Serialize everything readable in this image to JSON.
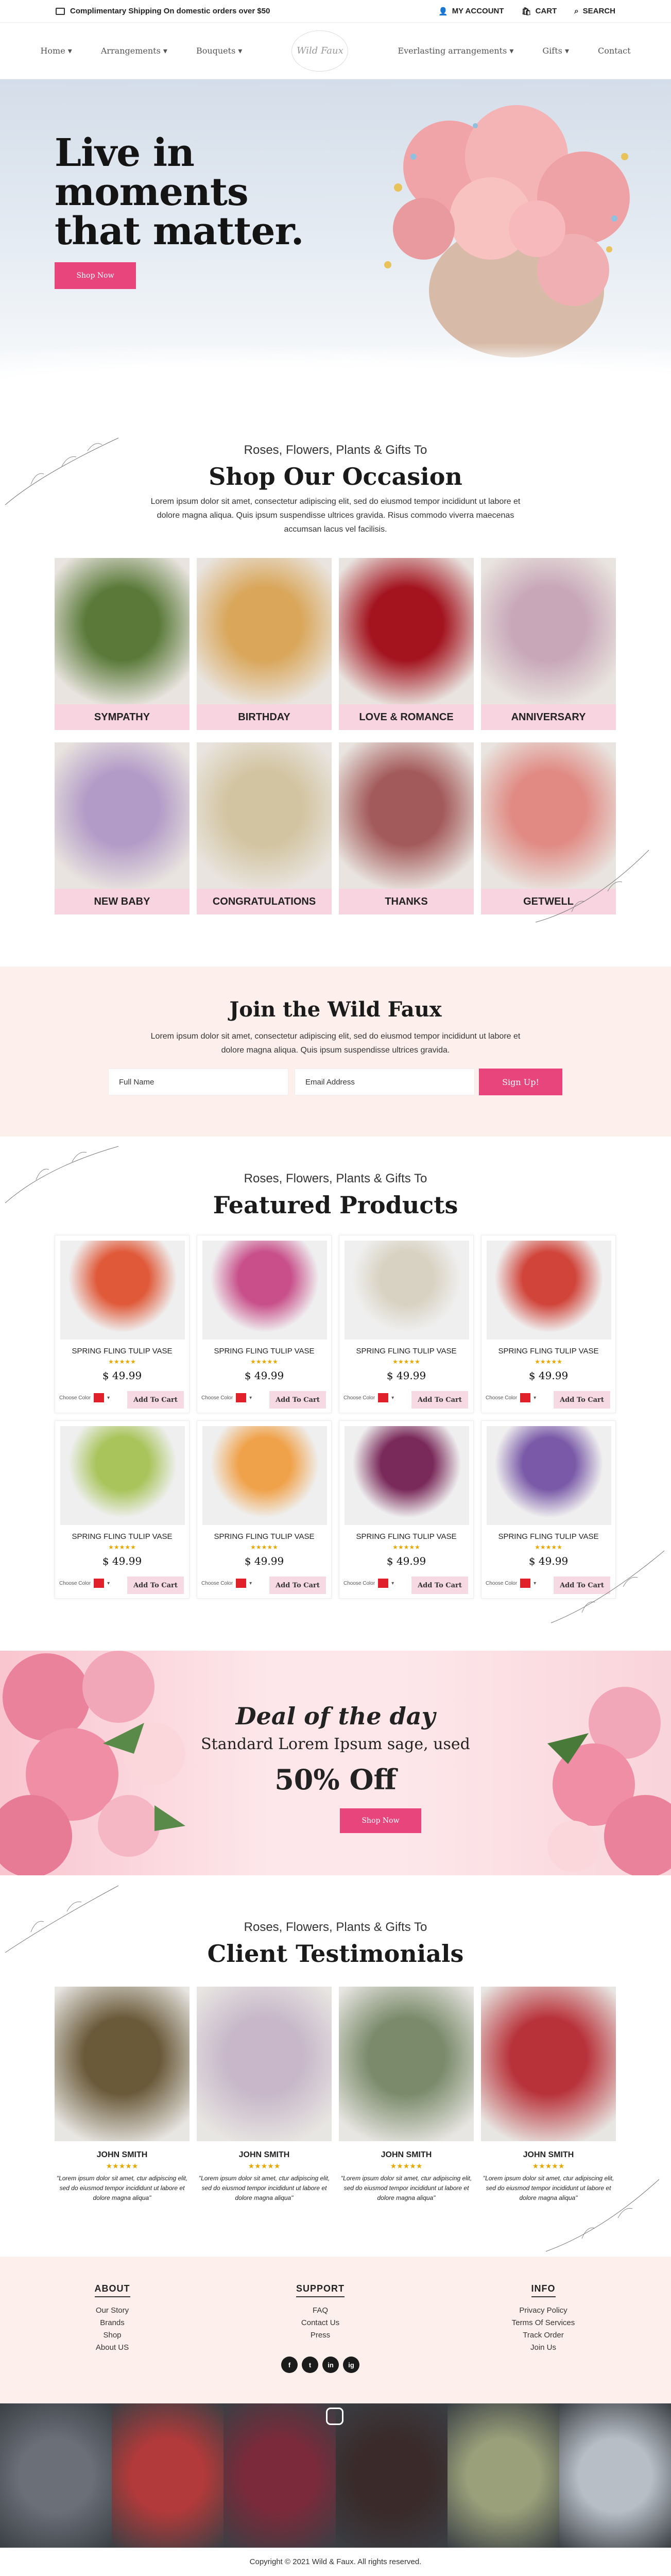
{
  "topbar": {
    "shipping": "Complimentary Shipping On domestic orders over $50",
    "account": "MY ACCOUNT",
    "cart": "CART",
    "search": "SEARCH"
  },
  "nav": {
    "items": [
      "Home",
      "Arrangements",
      "Bouquets",
      "Everlasting arrangements",
      "Gifts",
      "Contact"
    ],
    "logo": "Wild Faux"
  },
  "hero": {
    "title_line1": "Live in",
    "title_line2": "moments",
    "title_line3": "that matter.",
    "button": "Shop Now"
  },
  "occasion": {
    "subtitle": "Roses, Flowers, Plants & Gifts To",
    "title": "Shop Our Occasion",
    "text1": "Lorem ipsum dolor sit amet, consectetur adipiscing elit, sed do eiusmod tempor incididunt ut labore et",
    "text2": "dolore magna aliqua. Quis ipsum suspendisse ultrices gravida. Risus commodo viverra maecenas",
    "text3": "accumsan lacus vel facilisis.",
    "items": [
      {
        "label": "SYMPATHY",
        "color": "#5b7a3a"
      },
      {
        "label": "BIRTHDAY",
        "color": "#d9a65a"
      },
      {
        "label": "LOVE & ROMANCE",
        "color": "#a3141f"
      },
      {
        "label": "ANNIVERSARY",
        "color": "#c8a7b8"
      },
      {
        "label": "NEW BABY",
        "color": "#b39bc7"
      },
      {
        "label": "CONGRATULATIONS",
        "color": "#d2c4a0"
      },
      {
        "label": "THANKS",
        "color": "#a35a5a"
      },
      {
        "label": "GETWELL",
        "color": "#e08a83"
      }
    ]
  },
  "join": {
    "title": "Join the Wild Faux",
    "text1": "Lorem ipsum dolor sit amet, consectetur adipiscing elit, sed do eiusmod tempor incididunt ut labore et",
    "text2": "dolore magna aliqua. Quis ipsum suspendisse ultrices gravida.",
    "fullname": "Full Name",
    "email": "Email Address",
    "button": "Sign Up!"
  },
  "featured": {
    "subtitle": "Roses, Flowers, Plants & Gifts To",
    "title": "Featured Products",
    "products": [
      {
        "name": "SPRING FLING TULIP VASE",
        "stars": "★★★★★",
        "price": "$ 49.99",
        "color_label": "Choose Color",
        "cta": "Add To Cart",
        "tint": "#e05a3a"
      },
      {
        "name": "SPRING FLING TULIP VASE",
        "stars": "★★★★★",
        "price": "$ 49.99",
        "color_label": "Choose Color",
        "cta": "Add To Cart",
        "tint": "#c84f8a"
      },
      {
        "name": "SPRING FLING TULIP VASE",
        "stars": "★★★★★",
        "price": "$ 49.99",
        "color_label": "Choose Color",
        "cta": "Add To Cart",
        "tint": "#d8d2c2"
      },
      {
        "name": "SPRING FLING TULIP VASE",
        "stars": "★★★★★",
        "price": "$ 49.99",
        "color_label": "Choose Color",
        "cta": "Add To Cart",
        "tint": "#d0443a"
      },
      {
        "name": "SPRING FLING TULIP VASE",
        "stars": "★★★★★",
        "price": "$ 49.99",
        "color_label": "Choose Color",
        "cta": "Add To Cart",
        "tint": "#a8c45a"
      },
      {
        "name": "SPRING FLING TULIP VASE",
        "stars": "★★★★★",
        "price": "$ 49.99",
        "color_label": "Choose Color",
        "cta": "Add To Cart",
        "tint": "#f0a24a"
      },
      {
        "name": "SPRING FLING TULIP VASE",
        "stars": "★★★★★",
        "price": "$ 49.99",
        "color_label": "Choose Color",
        "cta": "Add To Cart",
        "tint": "#7a2a5a"
      },
      {
        "name": "SPRING FLING TULIP VASE",
        "stars": "★★★★★",
        "price": "$ 49.99",
        "color_label": "Choose Color",
        "cta": "Add To Cart",
        "tint": "#7a5aa8"
      }
    ]
  },
  "deal": {
    "title": "Deal of the day",
    "subtitle": "Standard Lorem Ipsum sage, used",
    "discount": "50% Off",
    "button": "Shop Now"
  },
  "testimonials": {
    "subtitle": "Roses, Flowers, Plants & Gifts To",
    "title": "Client Testimonials",
    "items": [
      {
        "name": "JOHN SMITH",
        "stars": "★★★★★",
        "quote": "\"Lorem ipsum dolor sit amet, ctur adipiscing elit, sed do eiusmod tempor incididunt ut labore et dolore magna aliqua\"",
        "tint": "#6a5a3a"
      },
      {
        "name": "JOHN SMITH",
        "stars": "★★★★★",
        "quote": "\"Lorem ipsum dolor sit amet, ctur adipiscing elit, sed do eiusmod tempor incididunt ut labore et dolore magna aliqua\"",
        "tint": "#c7b7c9"
      },
      {
        "name": "JOHN SMITH",
        "stars": "★★★★★",
        "quote": "\"Lorem ipsum dolor sit amet, ctur adipiscing elit, sed do eiusmod tempor incididunt ut labore et dolore magna aliqua\"",
        "tint": "#7a8a6a"
      },
      {
        "name": "JOHN SMITH",
        "stars": "★★★★★",
        "quote": "\"Lorem ipsum dolor sit amet, ctur adipiscing elit, sed do eiusmod tempor incididunt ut labore et dolore magna aliqua\"",
        "tint": "#b8323a"
      }
    ]
  },
  "footer": {
    "about": {
      "title": "ABOUT",
      "links": [
        "Our Story",
        "Brands",
        "Shop",
        "About US"
      ]
    },
    "support": {
      "title": "SUPPORT",
      "links": [
        "FAQ",
        "Contact Us",
        "Press"
      ]
    },
    "info": {
      "title": "INFO",
      "links": [
        "Privacy Policy",
        "Terms Of Services",
        "Track Order",
        "Join Us"
      ]
    },
    "social": [
      "f",
      "t",
      "in",
      "ig"
    ],
    "copyright": "Copyright © 2021 Wild & Faux. All rights reserved."
  },
  "instagram": {
    "tints": [
      "#6a6f78",
      "#b23a3a",
      "#7a2a3a",
      "#3a2a2a",
      "#9aa07a",
      "#b8bec6"
    ]
  }
}
